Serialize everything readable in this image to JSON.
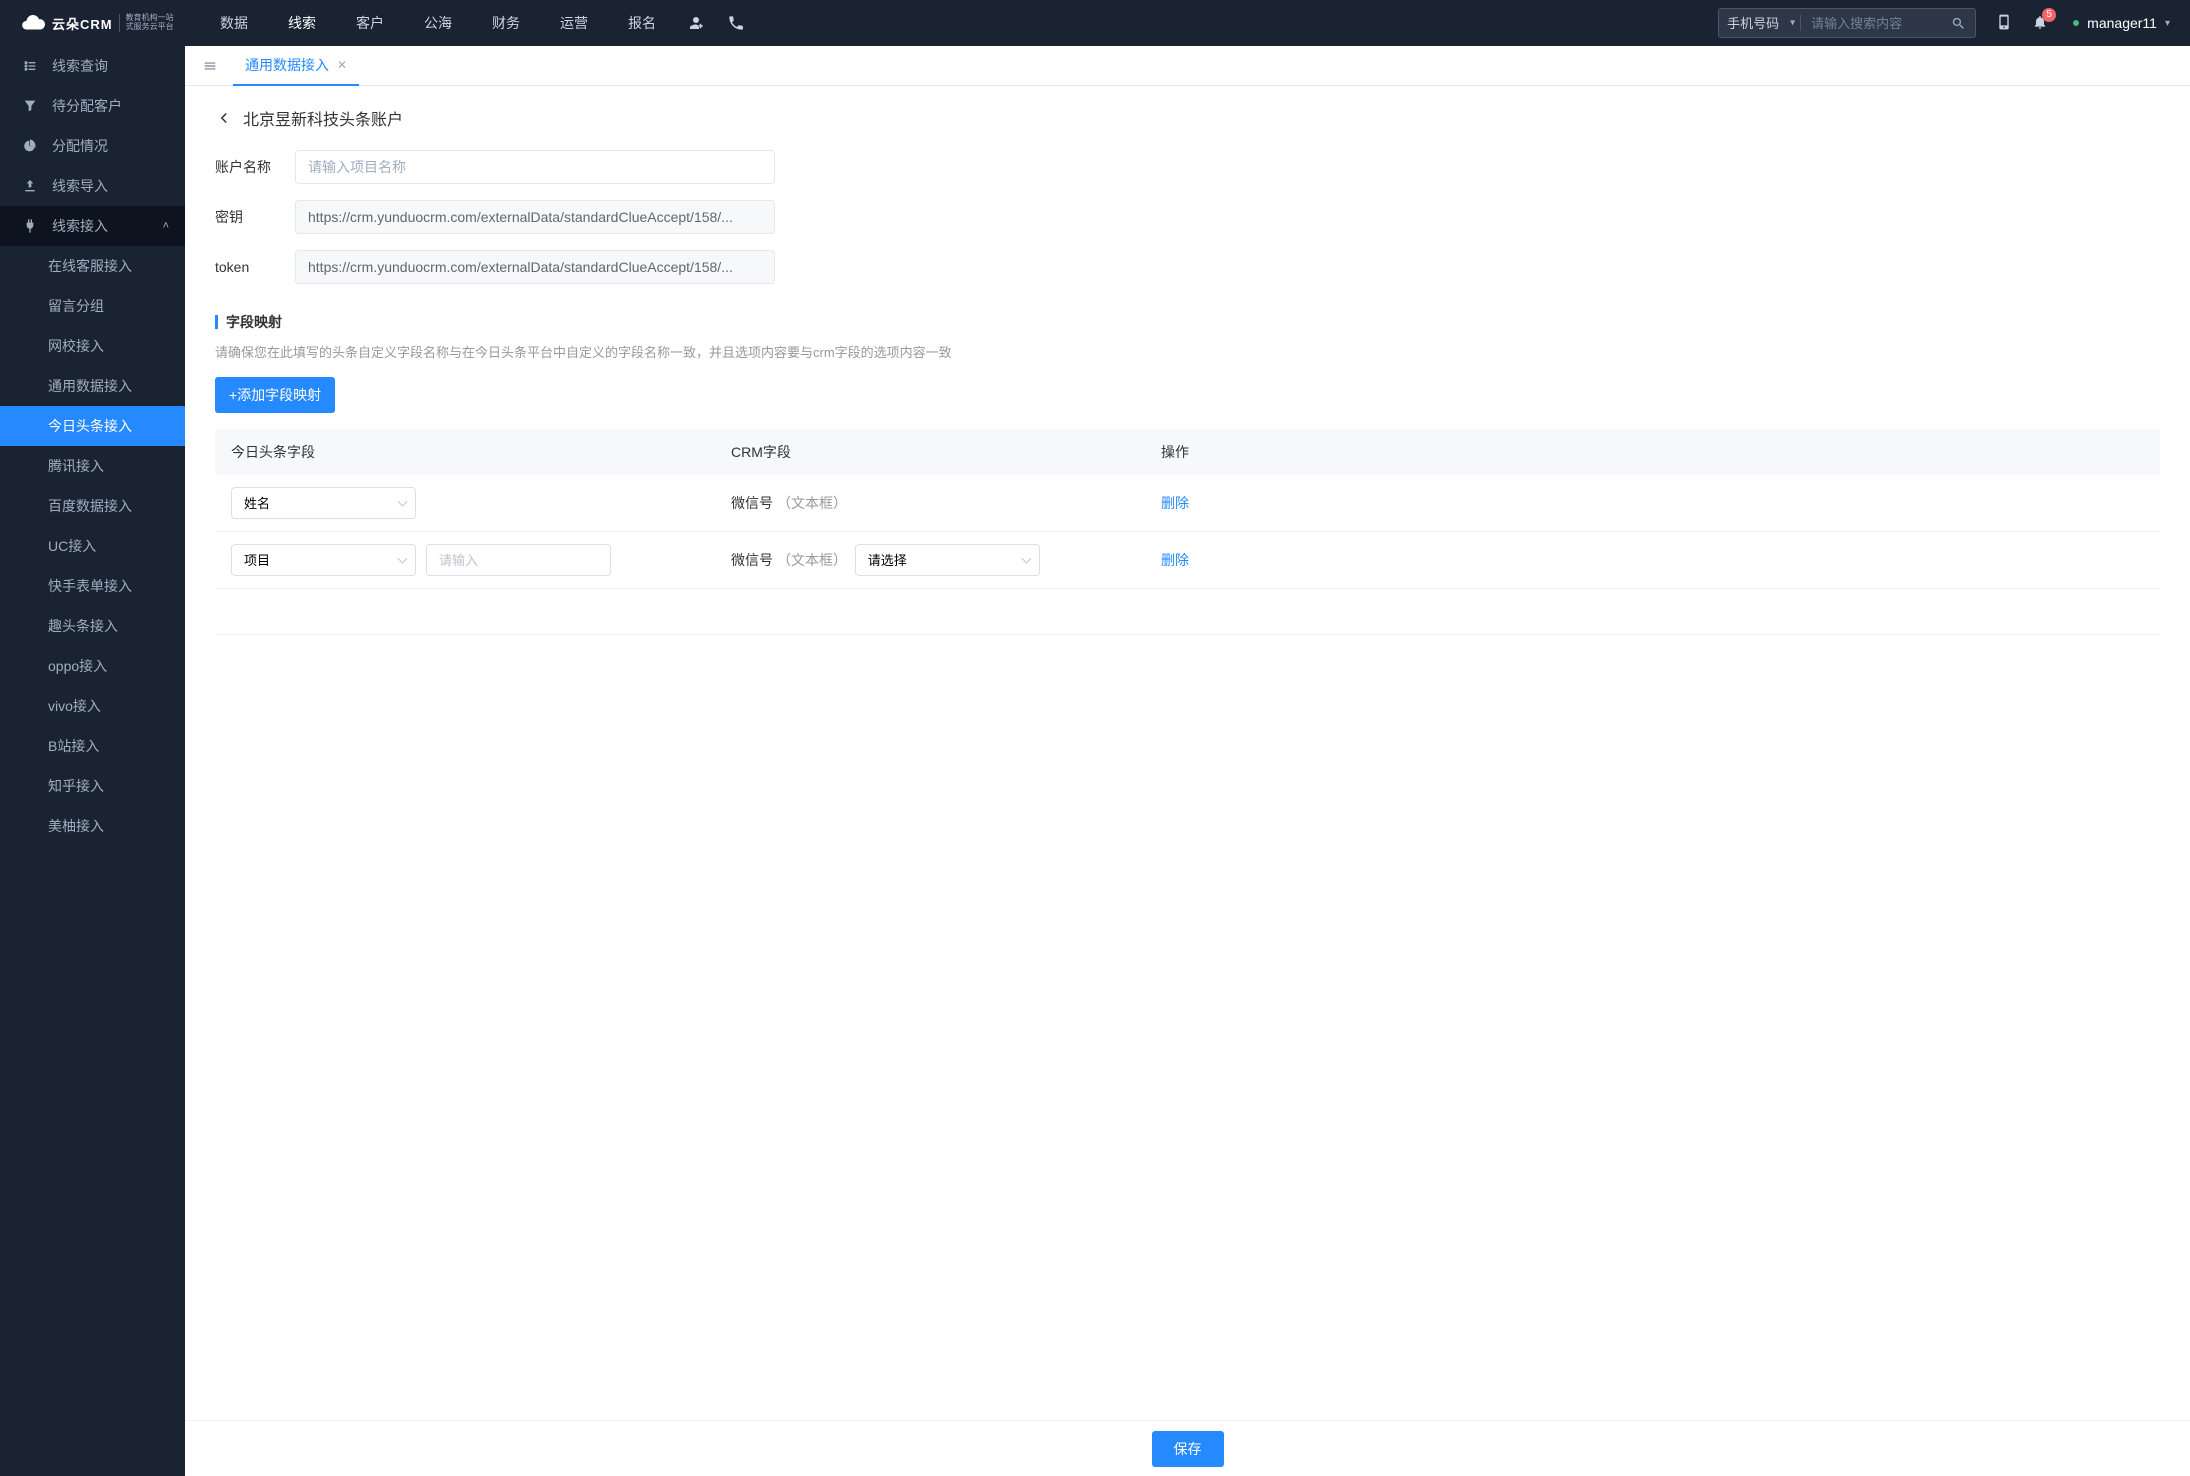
{
  "topnav": [
    "数据",
    "线索",
    "客户",
    "公海",
    "财务",
    "运营",
    "报名"
  ],
  "topnav_active": 1,
  "search": {
    "type_label": "手机号码",
    "placeholder": "请输入搜索内容"
  },
  "badge": "5",
  "user": "manager11",
  "sidebar": {
    "items": [
      {
        "label": "线索查询",
        "icon": "list"
      },
      {
        "label": "待分配客户",
        "icon": "filter"
      },
      {
        "label": "分配情况",
        "icon": "pie"
      },
      {
        "label": "线索导入",
        "icon": "upload"
      },
      {
        "label": "线索接入",
        "icon": "plug",
        "expanded": true
      }
    ],
    "sub": [
      "在线客服接入",
      "留言分组",
      "网校接入",
      "通用数据接入",
      "今日头条接入",
      "腾讯接入",
      "百度数据接入",
      "UC接入",
      "快手表单接入",
      "趣头条接入",
      "oppo接入",
      "vivo接入",
      "B站接入",
      "知乎接入",
      "美柚接入"
    ],
    "sub_active": 4
  },
  "tab": {
    "label": "通用数据接入"
  },
  "page": {
    "title": "北京昱新科技头条账户",
    "fields": {
      "name_label": "账户名称",
      "name_placeholder": "请输入项目名称",
      "key_label": "密钥",
      "key_value": "https://crm.yunduocrm.com/externalData/standardClueAccept/158/...",
      "token_label": "token",
      "token_value": "https://crm.yunduocrm.com/externalData/standardClueAccept/158/..."
    },
    "mapping": {
      "title": "字段映射",
      "hint": "请确保您在此填写的头条自定义字段名称与在今日头条平台中自定义的字段名称一致，并且选项内容要与crm字段的选项内容一致",
      "add_btn": "+添加字段映射",
      "cols": {
        "tt": "今日头条字段",
        "crm": "CRM字段",
        "op": "操作"
      },
      "rows": [
        {
          "tt_select": "姓名",
          "crm_label": "微信号",
          "crm_type": "（文本框）",
          "op": "删除",
          "has_extra": false
        },
        {
          "tt_select": "项目",
          "tt_input_ph": "请输入",
          "crm_label": "微信号",
          "crm_type": "（文本框）",
          "crm_select_ph": "请选择",
          "op": "删除",
          "has_extra": true
        }
      ]
    },
    "save": "保存"
  }
}
